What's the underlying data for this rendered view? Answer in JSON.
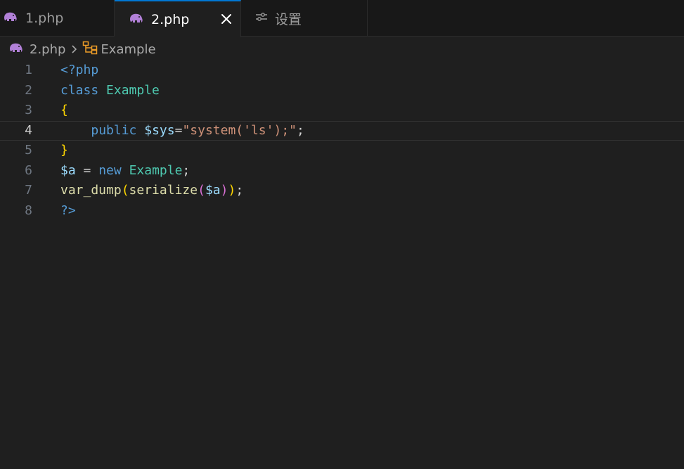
{
  "tabs": [
    {
      "label": "1.php",
      "icon": "php-elephant-icon",
      "active": false
    },
    {
      "label": "2.php",
      "icon": "php-elephant-icon",
      "active": true
    },
    {
      "label": "设置",
      "icon": "settings-sliders-icon",
      "active": false
    }
  ],
  "breadcrumb": {
    "file": "2.php",
    "symbol": "Example"
  },
  "editor": {
    "current_line": 4,
    "lines": [
      {
        "n": "1",
        "tokens": [
          {
            "t": "<?php",
            "c": "tag"
          }
        ]
      },
      {
        "n": "2",
        "tokens": [
          {
            "t": "class",
            "c": "kw"
          },
          {
            "t": " ",
            "c": "op"
          },
          {
            "t": "Example",
            "c": "cls"
          }
        ]
      },
      {
        "n": "3",
        "tokens": [
          {
            "t": "{",
            "c": "brace"
          }
        ]
      },
      {
        "n": "4",
        "tokens": [
          {
            "t": "    ",
            "c": "op"
          },
          {
            "t": "public",
            "c": "kw"
          },
          {
            "t": " ",
            "c": "op"
          },
          {
            "t": "$sys",
            "c": "var"
          },
          {
            "t": "=",
            "c": "op"
          },
          {
            "t": "\"system('ls');\"",
            "c": "str"
          },
          {
            "t": ";",
            "c": "op"
          }
        ]
      },
      {
        "n": "5",
        "tokens": [
          {
            "t": "}",
            "c": "brace"
          }
        ]
      },
      {
        "n": "6",
        "tokens": [
          {
            "t": "$a",
            "c": "var"
          },
          {
            "t": " = ",
            "c": "op"
          },
          {
            "t": "new",
            "c": "kw"
          },
          {
            "t": " ",
            "c": "op"
          },
          {
            "t": "Example",
            "c": "cls"
          },
          {
            "t": ";",
            "c": "op"
          }
        ]
      },
      {
        "n": "7",
        "tokens": [
          {
            "t": "var_dump",
            "c": "fn"
          },
          {
            "t": "(",
            "c": "paren1"
          },
          {
            "t": "serialize",
            "c": "fn"
          },
          {
            "t": "(",
            "c": "paren2"
          },
          {
            "t": "$a",
            "c": "var"
          },
          {
            "t": ")",
            "c": "paren2"
          },
          {
            "t": ")",
            "c": "paren1"
          },
          {
            "t": ";",
            "c": "op"
          }
        ]
      },
      {
        "n": "8",
        "tokens": [
          {
            "t": "?>",
            "c": "tag"
          }
        ]
      }
    ]
  },
  "colors": {
    "editor_bg": "#1f1f1f",
    "tab_bar_bg": "#181818",
    "active_tab_accent": "#0078d4",
    "php_icon": "#b180d7",
    "symbol_icon": "#ee9d28"
  }
}
